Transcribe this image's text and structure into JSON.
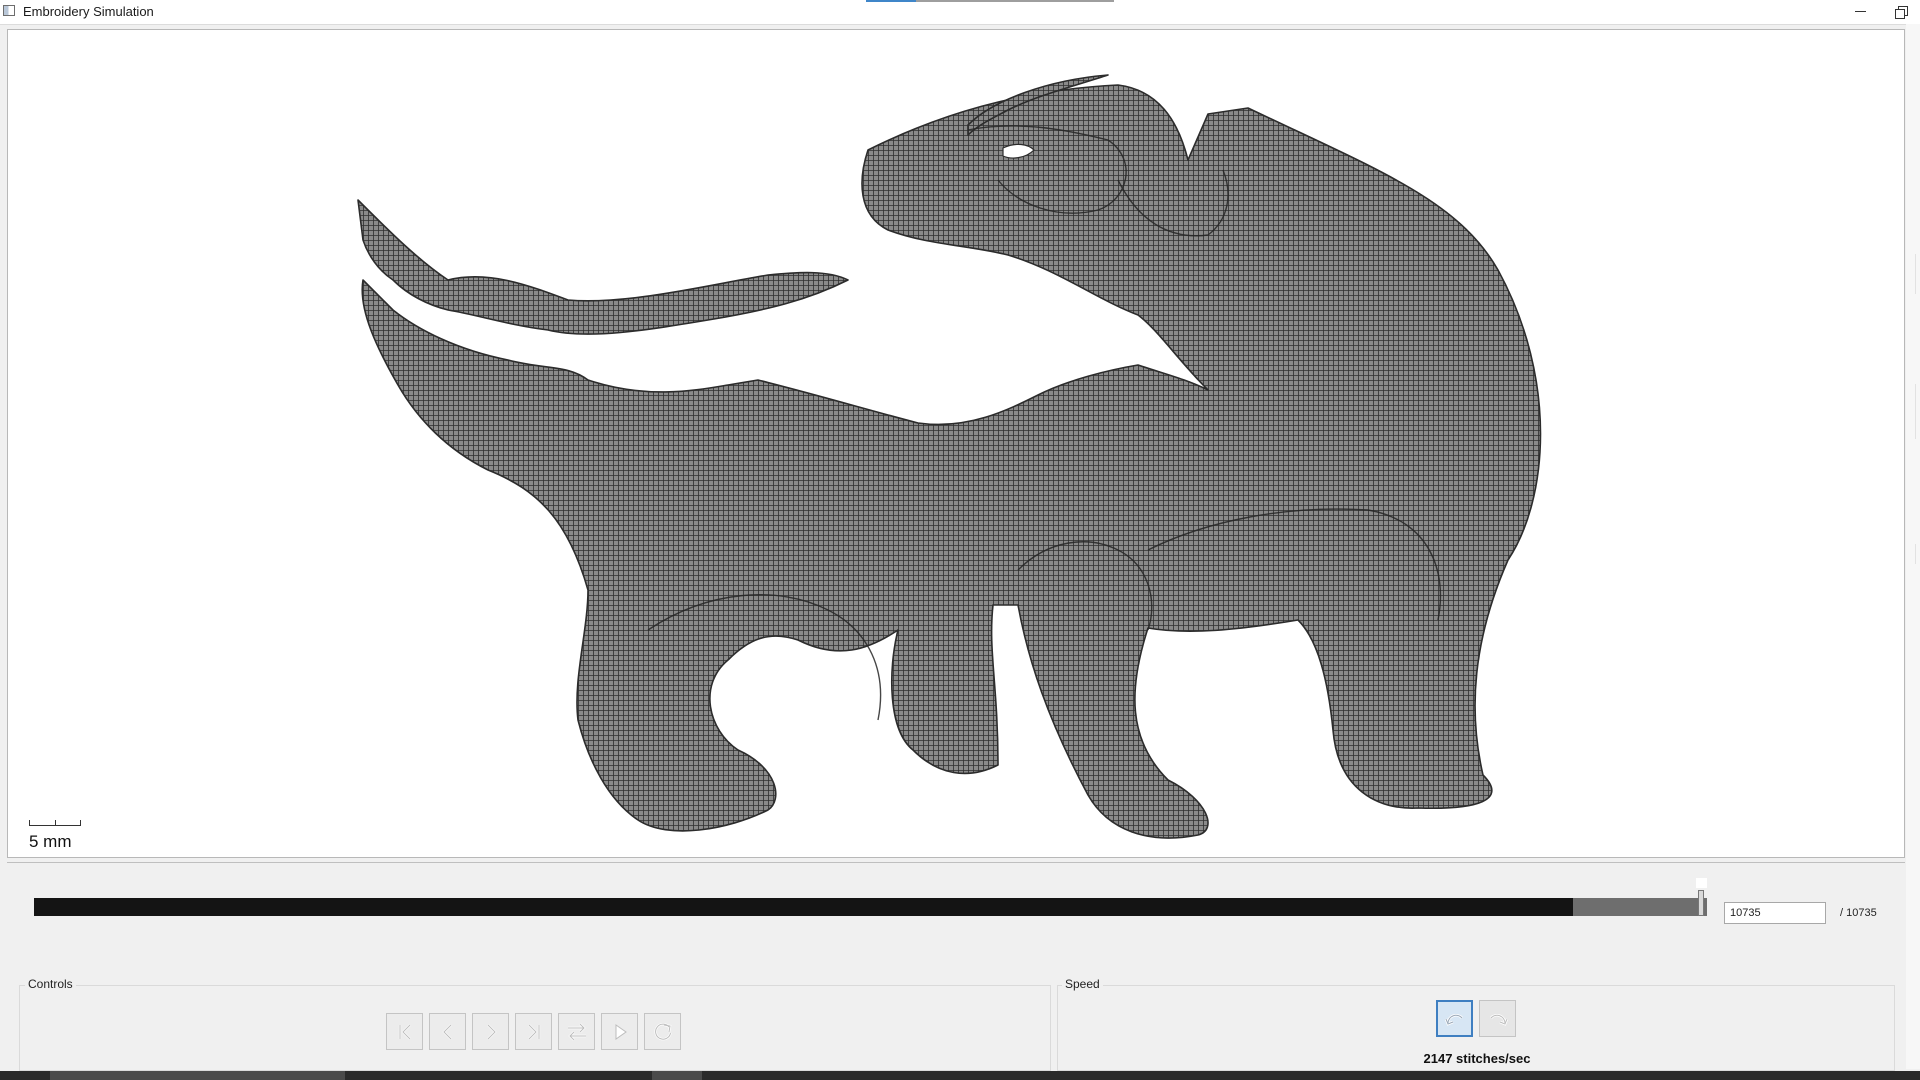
{
  "window": {
    "title": "Embroidery Simulation",
    "icons": {
      "app": "app-window-icon",
      "minimize": "minimize-icon",
      "restore": "restore-icon"
    }
  },
  "canvas": {
    "scale_label": "5 mm",
    "design": "embroidered-animal-figure",
    "stitch_color": "#2f2f2f",
    "fill_color": "#8a8a8a"
  },
  "progress": {
    "current_value": "10735",
    "total_label": "/ 10735",
    "current": 10735,
    "total": 10735,
    "sewn_fraction": 0.92
  },
  "controls": {
    "label": "Controls",
    "buttons": [
      {
        "name": "first-stitch-button",
        "icon": "skip-to-start-icon"
      },
      {
        "name": "previous-stitch-button",
        "icon": "step-back-icon"
      },
      {
        "name": "next-stitch-button",
        "icon": "step-forward-icon"
      },
      {
        "name": "last-stitch-button",
        "icon": "skip-to-end-icon"
      },
      {
        "name": "swap-direction-button",
        "icon": "swap-icon"
      },
      {
        "name": "play-button",
        "icon": "play-icon"
      },
      {
        "name": "reset-button",
        "icon": "refresh-icon"
      }
    ]
  },
  "speed": {
    "label": "Speed",
    "readout": "2147 stitches/sec",
    "buttons": [
      {
        "name": "slower-speed-button",
        "icon": "slow-down-icon",
        "active": true
      },
      {
        "name": "faster-speed-button",
        "icon": "speed-up-icon",
        "active": false
      }
    ]
  },
  "colors": {
    "accent": "#3f7fc1",
    "track_done": "#141414",
    "track_remaining": "#6e6e6e"
  }
}
